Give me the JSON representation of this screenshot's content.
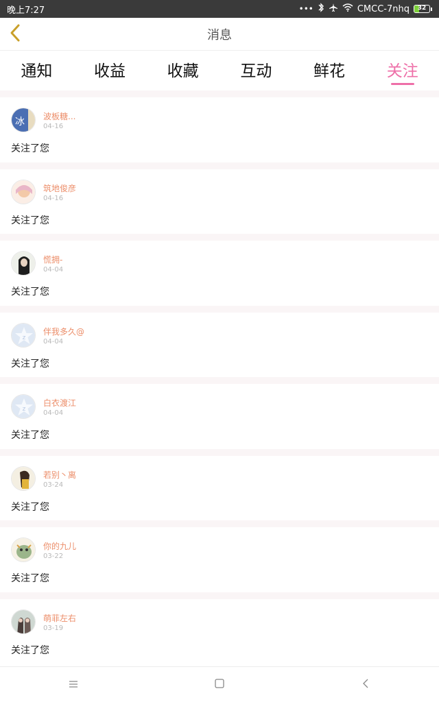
{
  "status_bar": {
    "time": "晚上7:27",
    "dots": "•••",
    "network": "CMCC-7nhq",
    "battery": 32,
    "battery_label": "32",
    "icons": [
      "bluetooth-icon",
      "airplane-icon",
      "wifi-icon"
    ]
  },
  "header": {
    "title": "消息",
    "back_icon": "chevron-left-icon"
  },
  "tabs": [
    {
      "label": "通知",
      "active": false
    },
    {
      "label": "收益",
      "active": false
    },
    {
      "label": "收藏",
      "active": false
    },
    {
      "label": "互动",
      "active": false
    },
    {
      "label": "鲜花",
      "active": false
    },
    {
      "label": "关注",
      "active": true
    }
  ],
  "items": [
    {
      "name": "波板糖...",
      "date": "04-16",
      "message": "关注了您"
    },
    {
      "name": "筑地俊彦",
      "date": "04-16",
      "message": "关注了您"
    },
    {
      "name": "慌拥-",
      "date": "04-04",
      "message": "关注了您"
    },
    {
      "name": "伴我多久@",
      "date": "04-04",
      "message": "关注了您"
    },
    {
      "name": "白衣渡江",
      "date": "04-04",
      "message": "关注了您"
    },
    {
      "name": "若别丶离",
      "date": "03-24",
      "message": "关注了您"
    },
    {
      "name": "你的九儿",
      "date": "03-22",
      "message": "关注了您"
    },
    {
      "name": "萌菲左右",
      "date": "03-19",
      "message": "关注了您"
    }
  ],
  "nav": [
    "menu-icon",
    "home-square-icon",
    "back-icon"
  ],
  "colors": {
    "accent": "#ee6fa8",
    "username": "#ec8e6a",
    "back_arrow": "#c9a02a"
  }
}
